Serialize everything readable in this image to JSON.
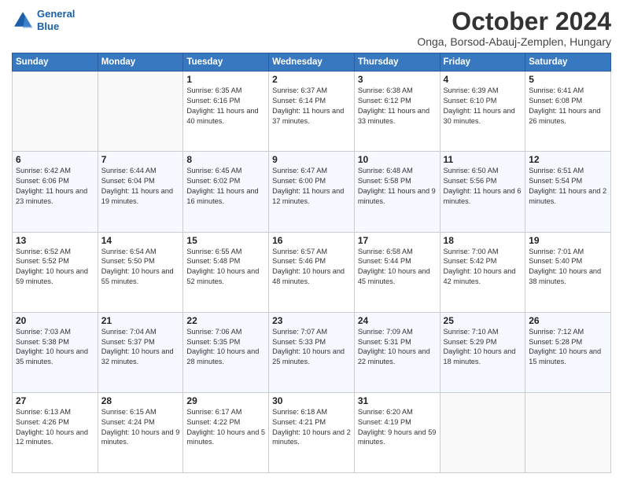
{
  "header": {
    "logo_line1": "General",
    "logo_line2": "Blue",
    "month_title": "October 2024",
    "location": "Onga, Borsod-Abauj-Zemplen, Hungary"
  },
  "weekdays": [
    "Sunday",
    "Monday",
    "Tuesday",
    "Wednesday",
    "Thursday",
    "Friday",
    "Saturday"
  ],
  "weeks": [
    [
      {
        "day": "",
        "info": ""
      },
      {
        "day": "",
        "info": ""
      },
      {
        "day": "1",
        "info": "Sunrise: 6:35 AM\nSunset: 6:16 PM\nDaylight: 11 hours and 40 minutes."
      },
      {
        "day": "2",
        "info": "Sunrise: 6:37 AM\nSunset: 6:14 PM\nDaylight: 11 hours and 37 minutes."
      },
      {
        "day": "3",
        "info": "Sunrise: 6:38 AM\nSunset: 6:12 PM\nDaylight: 11 hours and 33 minutes."
      },
      {
        "day": "4",
        "info": "Sunrise: 6:39 AM\nSunset: 6:10 PM\nDaylight: 11 hours and 30 minutes."
      },
      {
        "day": "5",
        "info": "Sunrise: 6:41 AM\nSunset: 6:08 PM\nDaylight: 11 hours and 26 minutes."
      }
    ],
    [
      {
        "day": "6",
        "info": "Sunrise: 6:42 AM\nSunset: 6:06 PM\nDaylight: 11 hours and 23 minutes."
      },
      {
        "day": "7",
        "info": "Sunrise: 6:44 AM\nSunset: 6:04 PM\nDaylight: 11 hours and 19 minutes."
      },
      {
        "day": "8",
        "info": "Sunrise: 6:45 AM\nSunset: 6:02 PM\nDaylight: 11 hours and 16 minutes."
      },
      {
        "day": "9",
        "info": "Sunrise: 6:47 AM\nSunset: 6:00 PM\nDaylight: 11 hours and 12 minutes."
      },
      {
        "day": "10",
        "info": "Sunrise: 6:48 AM\nSunset: 5:58 PM\nDaylight: 11 hours and 9 minutes."
      },
      {
        "day": "11",
        "info": "Sunrise: 6:50 AM\nSunset: 5:56 PM\nDaylight: 11 hours and 6 minutes."
      },
      {
        "day": "12",
        "info": "Sunrise: 6:51 AM\nSunset: 5:54 PM\nDaylight: 11 hours and 2 minutes."
      }
    ],
    [
      {
        "day": "13",
        "info": "Sunrise: 6:52 AM\nSunset: 5:52 PM\nDaylight: 10 hours and 59 minutes."
      },
      {
        "day": "14",
        "info": "Sunrise: 6:54 AM\nSunset: 5:50 PM\nDaylight: 10 hours and 55 minutes."
      },
      {
        "day": "15",
        "info": "Sunrise: 6:55 AM\nSunset: 5:48 PM\nDaylight: 10 hours and 52 minutes."
      },
      {
        "day": "16",
        "info": "Sunrise: 6:57 AM\nSunset: 5:46 PM\nDaylight: 10 hours and 48 minutes."
      },
      {
        "day": "17",
        "info": "Sunrise: 6:58 AM\nSunset: 5:44 PM\nDaylight: 10 hours and 45 minutes."
      },
      {
        "day": "18",
        "info": "Sunrise: 7:00 AM\nSunset: 5:42 PM\nDaylight: 10 hours and 42 minutes."
      },
      {
        "day": "19",
        "info": "Sunrise: 7:01 AM\nSunset: 5:40 PM\nDaylight: 10 hours and 38 minutes."
      }
    ],
    [
      {
        "day": "20",
        "info": "Sunrise: 7:03 AM\nSunset: 5:38 PM\nDaylight: 10 hours and 35 minutes."
      },
      {
        "day": "21",
        "info": "Sunrise: 7:04 AM\nSunset: 5:37 PM\nDaylight: 10 hours and 32 minutes."
      },
      {
        "day": "22",
        "info": "Sunrise: 7:06 AM\nSunset: 5:35 PM\nDaylight: 10 hours and 28 minutes."
      },
      {
        "day": "23",
        "info": "Sunrise: 7:07 AM\nSunset: 5:33 PM\nDaylight: 10 hours and 25 minutes."
      },
      {
        "day": "24",
        "info": "Sunrise: 7:09 AM\nSunset: 5:31 PM\nDaylight: 10 hours and 22 minutes."
      },
      {
        "day": "25",
        "info": "Sunrise: 7:10 AM\nSunset: 5:29 PM\nDaylight: 10 hours and 18 minutes."
      },
      {
        "day": "26",
        "info": "Sunrise: 7:12 AM\nSunset: 5:28 PM\nDaylight: 10 hours and 15 minutes."
      }
    ],
    [
      {
        "day": "27",
        "info": "Sunrise: 6:13 AM\nSunset: 4:26 PM\nDaylight: 10 hours and 12 minutes."
      },
      {
        "day": "28",
        "info": "Sunrise: 6:15 AM\nSunset: 4:24 PM\nDaylight: 10 hours and 9 minutes."
      },
      {
        "day": "29",
        "info": "Sunrise: 6:17 AM\nSunset: 4:22 PM\nDaylight: 10 hours and 5 minutes."
      },
      {
        "day": "30",
        "info": "Sunrise: 6:18 AM\nSunset: 4:21 PM\nDaylight: 10 hours and 2 minutes."
      },
      {
        "day": "31",
        "info": "Sunrise: 6:20 AM\nSunset: 4:19 PM\nDaylight: 9 hours and 59 minutes."
      },
      {
        "day": "",
        "info": ""
      },
      {
        "day": "",
        "info": ""
      }
    ]
  ]
}
